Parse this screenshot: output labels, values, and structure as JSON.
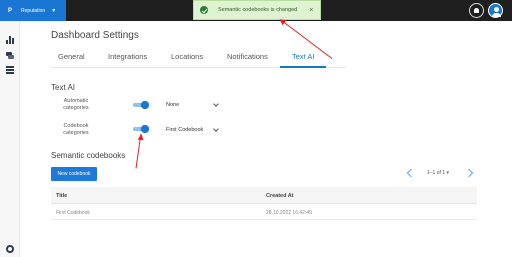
{
  "app": {
    "logo": "P",
    "name": "Reputation"
  },
  "toast": {
    "message": "Semantic codebooks is changed",
    "close": "×"
  },
  "header": {
    "title": "Dashboard Settings"
  },
  "tabs": [
    {
      "label": "General"
    },
    {
      "label": "Integrations"
    },
    {
      "label": "Locations"
    },
    {
      "label": "Notifications"
    },
    {
      "label": "Text AI"
    }
  ],
  "text_ai": {
    "title": "Text AI",
    "automatic": {
      "label": "Automatic categories",
      "enabled": true,
      "value": "None"
    },
    "codebook": {
      "label": "Codebook categories",
      "enabled": true,
      "value": "First Codebook"
    }
  },
  "semantic": {
    "title": "Semantic codebooks",
    "new_button": "New codebook",
    "pagination": "1–1 of 1 ▾",
    "columns": [
      "Title",
      "Created At"
    ],
    "rows": [
      {
        "title": "First Codebook",
        "created_at": "28.10.2022 16:42:49"
      }
    ]
  },
  "colors": {
    "accent": "#1976d2",
    "toast_bg": "#dff2d2",
    "annotation": "#e02424",
    "topbar": "#1f1f1f"
  }
}
